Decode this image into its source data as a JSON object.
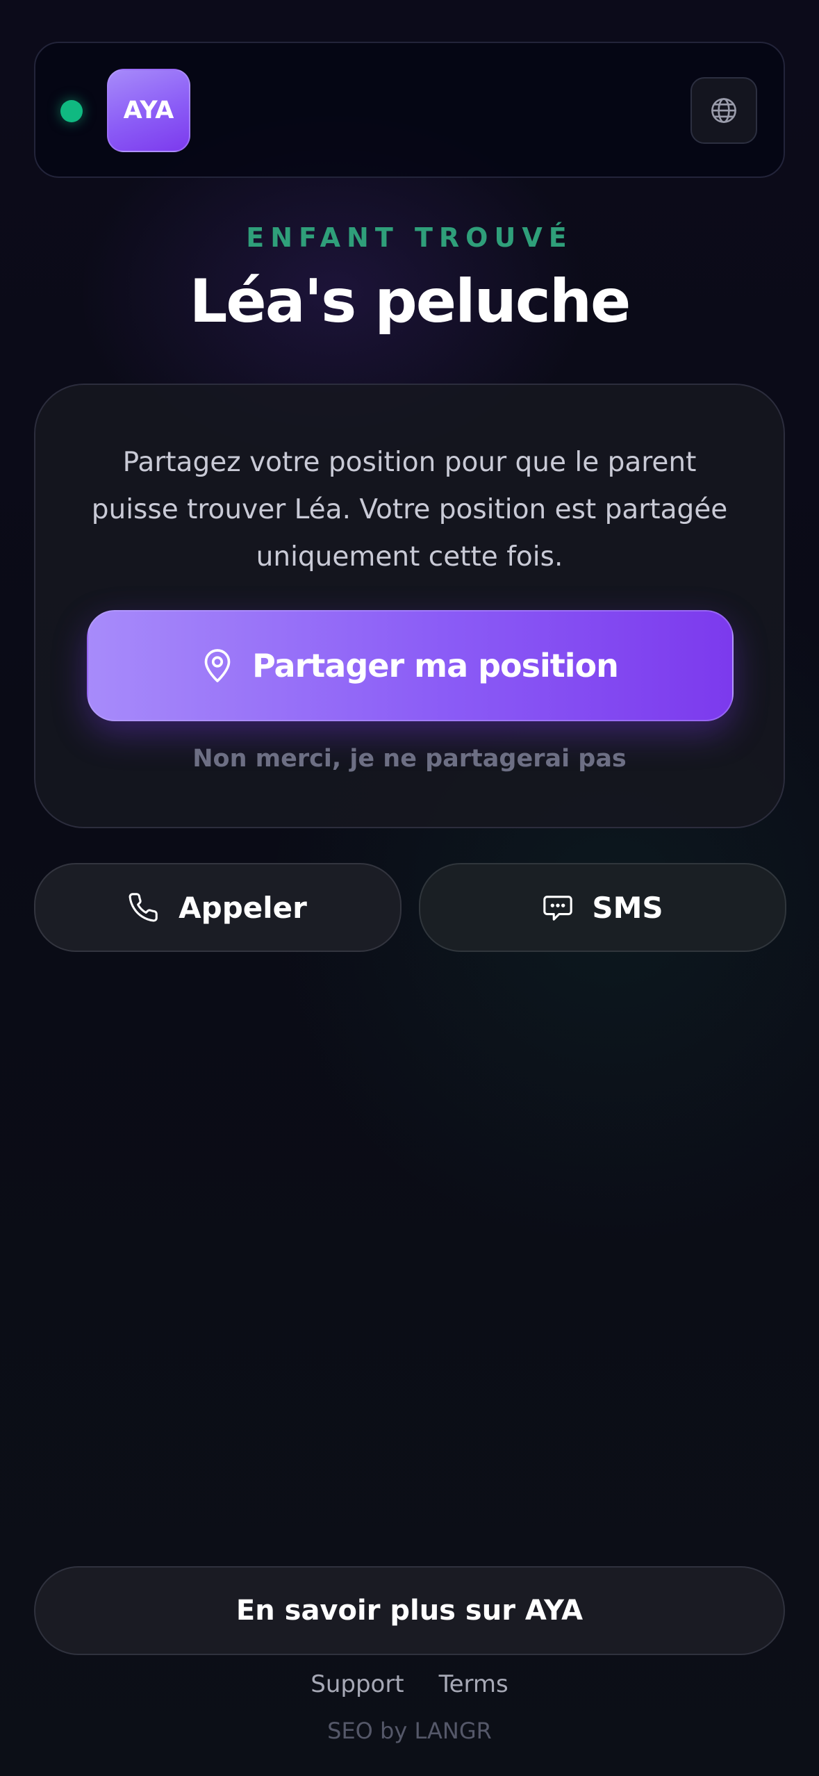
{
  "header": {
    "logo_text": "AYA",
    "status_color": "#10b981",
    "language_icon": "globe-icon"
  },
  "hero": {
    "eyebrow": "ENFANT TROUVÉ",
    "title": "Léa's peluche"
  },
  "card": {
    "description": "Partagez votre position pour que le parent puisse trouver Léa. Votre position est partagée uniquement cette fois.",
    "share_button": {
      "icon": "map-pin-icon",
      "label": "Partager ma position"
    },
    "decline_label": "Non merci, je ne partagerai pas"
  },
  "actions": {
    "call": {
      "icon": "phone-icon",
      "label": "Appeler"
    },
    "sms": {
      "icon": "chat-bubble-icon",
      "label": "SMS"
    }
  },
  "footer": {
    "learn_more": "En savoir plus sur AYA",
    "links": [
      "Support",
      "Terms"
    ],
    "credit": "SEO by LANGR"
  },
  "colors": {
    "accent_purple": "#8b5cf6",
    "accent_green": "#2f9f7a",
    "background": "#0c0b1a"
  }
}
